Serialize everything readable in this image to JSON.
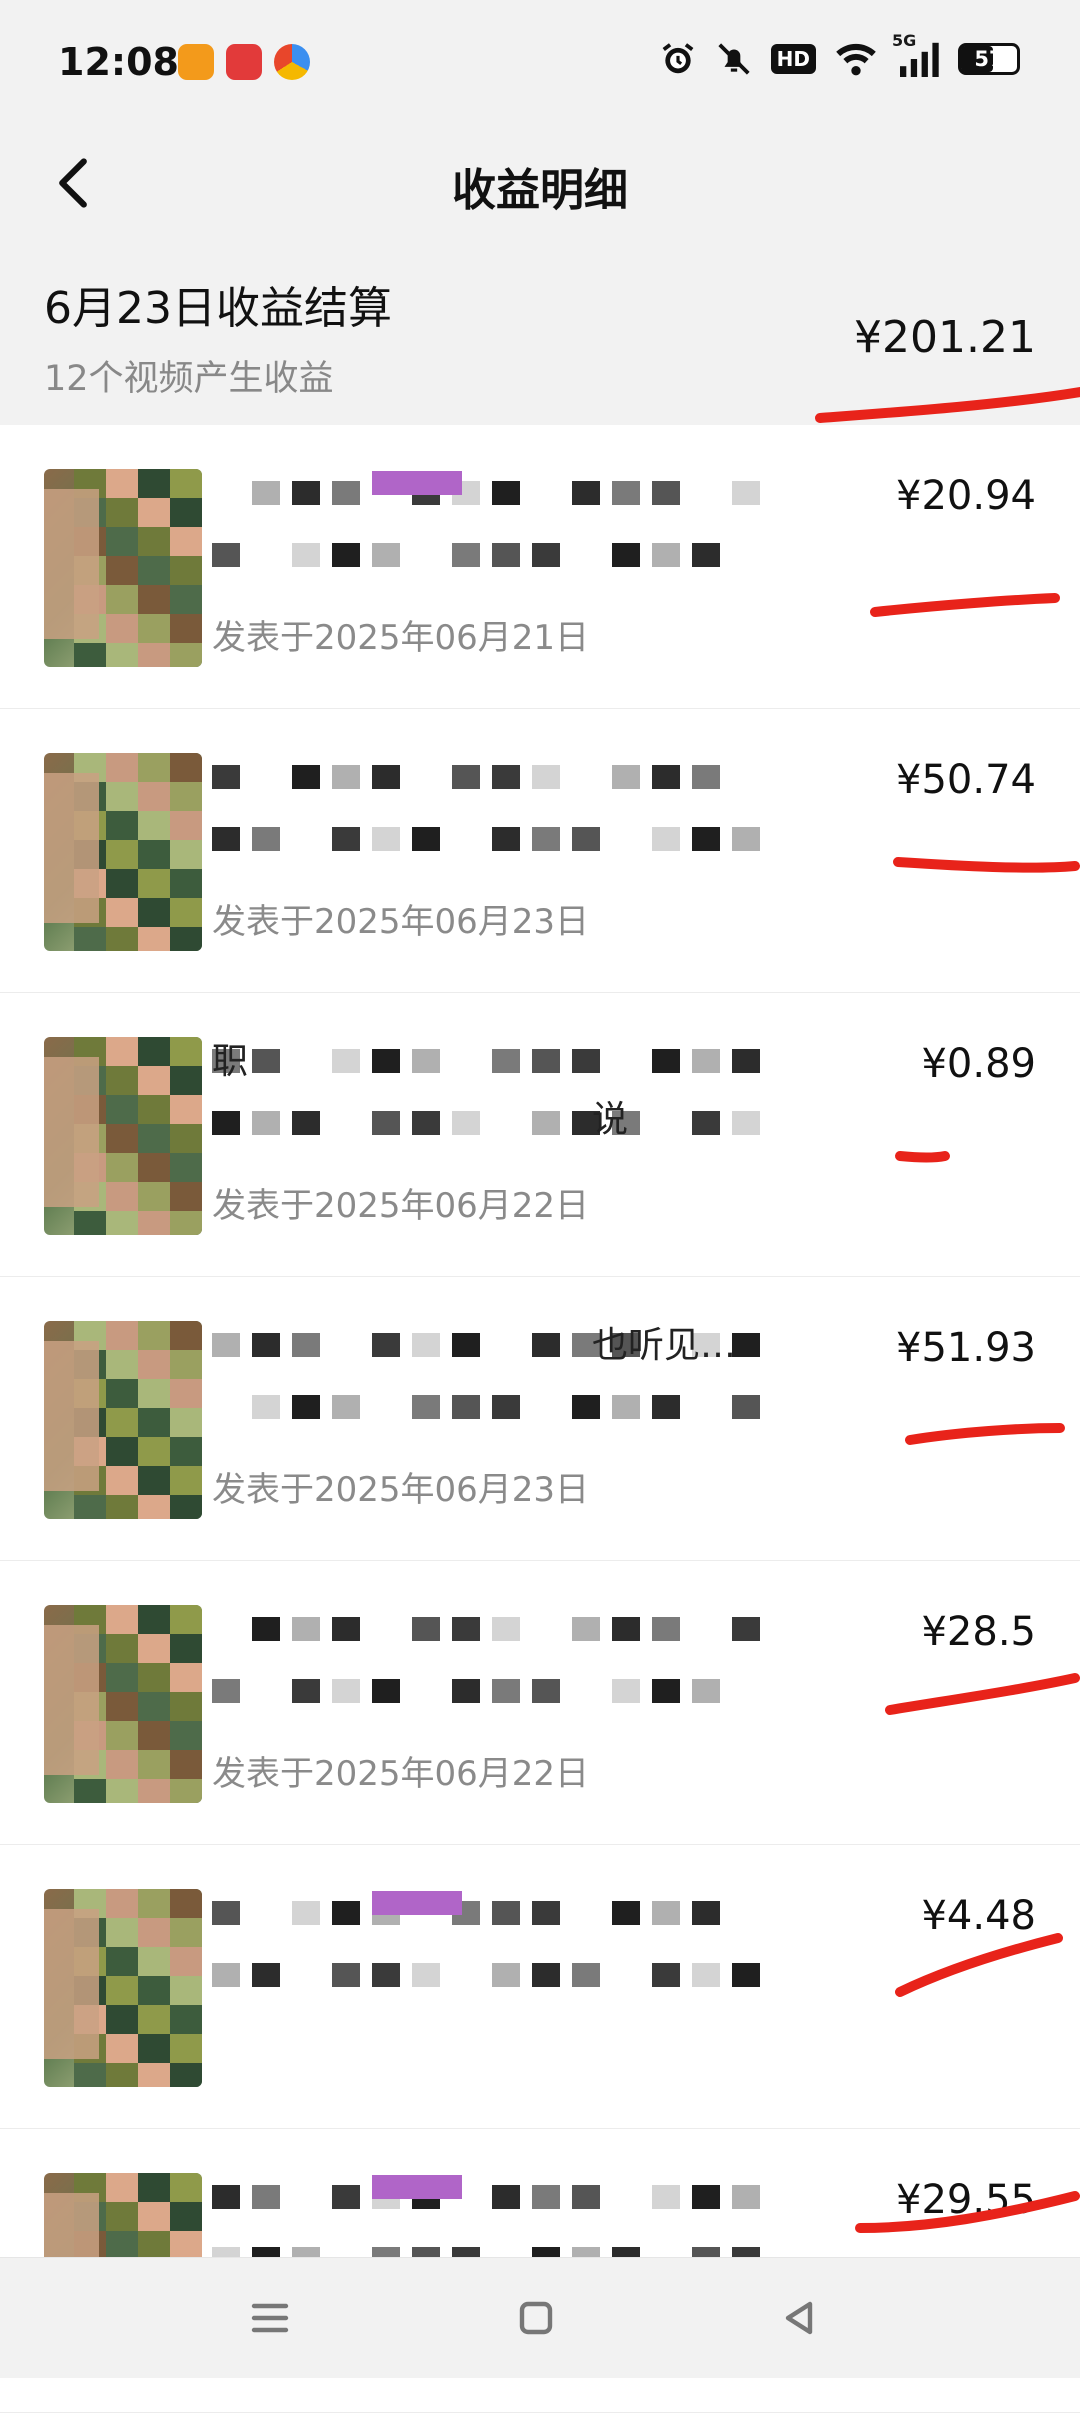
{
  "status_bar": {
    "time": "12:08",
    "battery": "57",
    "network": "5G",
    "hd_label": "HD"
  },
  "header": {
    "title": "收益明细",
    "back_icon": "chevron-left-icon"
  },
  "summary": {
    "title": "6月23日收益结算",
    "subtitle": "12个视频产生收益",
    "total": "¥201.21"
  },
  "items": [
    {
      "title_line1": "",
      "title_line2": "",
      "date": "发表于2025年06月21日",
      "amount": "¥20.94"
    },
    {
      "title_line1": "",
      "title_line2": "",
      "date": "发表于2025年06月23日",
      "amount": "¥50.74"
    },
    {
      "title_line1": "职",
      "title_line2": "说",
      "date": "发表于2025年06月22日",
      "amount": "¥0.89"
    },
    {
      "title_line1": "",
      "title_line2": "也听见…",
      "date": "发表于2025年06月23日",
      "amount": "¥51.93"
    },
    {
      "title_line1": "",
      "title_line2": "",
      "date": "发表于2025年06月22日",
      "amount": "¥28.5"
    },
    {
      "title_line1": "",
      "title_line2": "",
      "date": "",
      "amount": "¥4.48"
    },
    {
      "title_line1": "",
      "title_line2": "",
      "date": "",
      "amount": "¥29.55"
    }
  ],
  "bottom_nav": {
    "items": [
      "menu-icon",
      "home-icon",
      "back-triangle-icon"
    ]
  },
  "colors": {
    "background": "#ffffff",
    "header_bg": "#f2f2f2",
    "text_primary": "#111111",
    "text_secondary": "#888888",
    "annotation": "#e8231a"
  }
}
